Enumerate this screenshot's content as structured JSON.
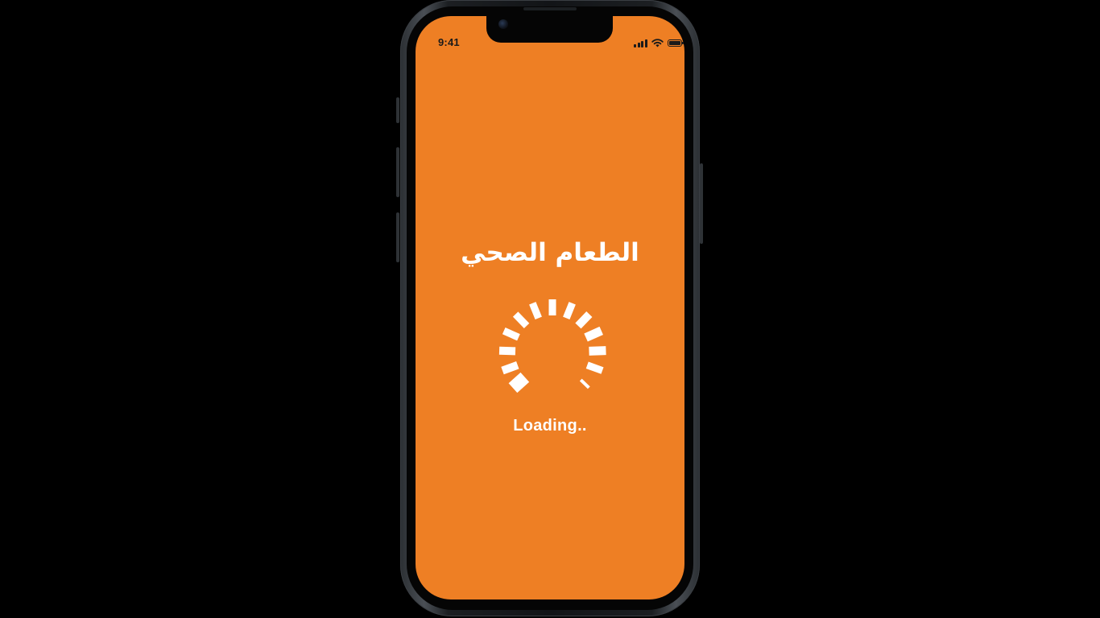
{
  "status_bar": {
    "time": "9:41",
    "icons": [
      "signal-icon",
      "wifi-icon",
      "battery-icon"
    ]
  },
  "splash": {
    "title": "الطعام الصحي",
    "loading_text": "Loading..",
    "spinner_icon": "loading-spinner-icon"
  },
  "colors": {
    "screen_background": "#EE7F24",
    "text": "#FFFFFF",
    "status_text": "#1A1A1A",
    "device_frame": "#121417"
  }
}
